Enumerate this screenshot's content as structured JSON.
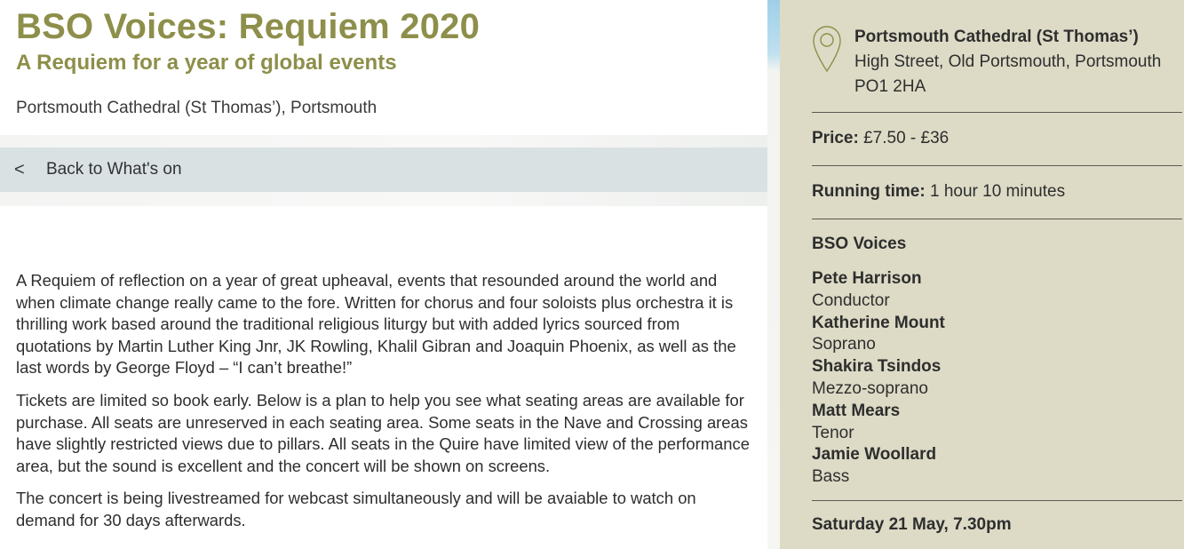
{
  "event": {
    "title": "BSO Voices: Requiem 2020",
    "subtitle": "A Requiem for a year of global events",
    "location": "Portsmouth Cathedral (St Thomas’), Portsmouth"
  },
  "nav": {
    "back_chevron": "<",
    "back_label": "Back to What's on"
  },
  "description": [
    "A Requiem of reflection on a year of great upheaval, events that resounded around the world and when climate change really came to the fore. Written for chorus and four soloists plus orchestra it is thrilling work based around the traditional religious liturgy but with added lyrics sourced from quotations by Martin Luther King Jnr, JK Rowling, Khalil Gibran and Joaquin Phoenix, as well as the last words by George Floyd – “I can’t breathe!”",
    "Tickets are limited so book early. Below is a plan to help you see what seating areas are available for purchase. All seats are unreserved in each seating area. Some seats in the Nave and Crossing areas have slightly restricted views due to pillars. All seats in the Quire have limited view of the performance area, but the sound is excellent and the concert will be shown on screens.",
    "The concert is being livestreamed for webcast simultaneously and will be avaiable to watch on demand for 30 days afterwards."
  ],
  "sidebar": {
    "venue_icon": "map-pin-icon",
    "venue_name": "Portsmouth Cathedral (St Thomas’)",
    "venue_address_line1": "High Street, Old Portsmouth, Portsmouth",
    "venue_address_line2": "PO1 2HA",
    "price_label": "Price:",
    "price_value": "£7.50 - £36",
    "running_label": "Running time:",
    "running_value": "1 hour 10 minutes",
    "ensemble": "BSO Voices",
    "performers": [
      {
        "name": "Pete Harrison",
        "role": "Conductor"
      },
      {
        "name": "Katherine Mount",
        "role": "Soprano"
      },
      {
        "name": "Shakira Tsindos",
        "role": "Mezzo-soprano"
      },
      {
        "name": "Matt Mears",
        "role": "Tenor"
      },
      {
        "name": "Jamie Woollard",
        "role": "Bass"
      }
    ],
    "date": "Saturday 21 May, 7.30pm"
  },
  "colors": {
    "accent_olive": "#8d8f4a",
    "sidebar_bg": "#dddbc6",
    "back_bar_bg": "#d9e1e3"
  }
}
